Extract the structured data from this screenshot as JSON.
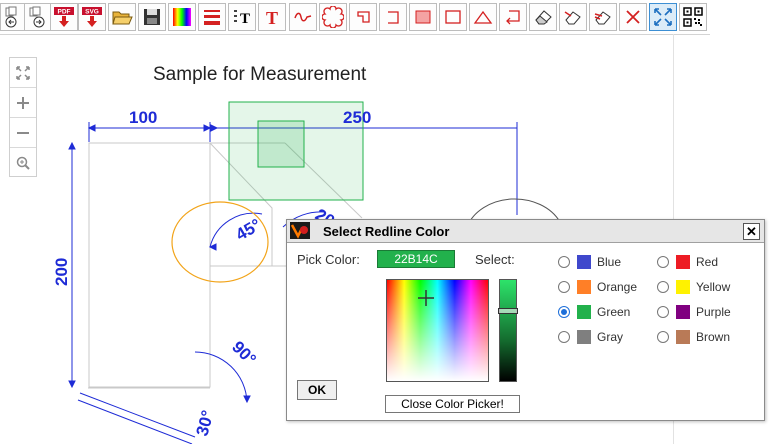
{
  "drawing": {
    "title": "Sample for Measurement",
    "dims": [
      "100",
      "250",
      "200",
      "45°",
      "20",
      "90°",
      "30°"
    ]
  },
  "toolbar": {
    "pdf_label": "PDF",
    "svg_label": "SVG",
    "text_tool_label": "T",
    "colors": {
      "red": "#e0242d",
      "toolbar_border": "#bdbdbd"
    }
  },
  "dialog": {
    "title": "Select Redline Color",
    "close_symbol": "✕",
    "pick_label": "Pick Color:",
    "pick_value": "22B14C",
    "select_label": "Select:",
    "ok_label": "OK",
    "close_picker_label": "Close Color Picker!",
    "options": [
      {
        "label": "Blue",
        "color": "#3f48cc",
        "selected": false
      },
      {
        "label": "Red",
        "color": "#ed1c24",
        "selected": false
      },
      {
        "label": "Orange",
        "color": "#ff7f27",
        "selected": false
      },
      {
        "label": "Yellow",
        "color": "#fff200",
        "selected": false
      },
      {
        "label": "Green",
        "color": "#22b14c",
        "selected": true
      },
      {
        "label": "Purple",
        "color": "#800080",
        "selected": false
      },
      {
        "label": "Gray",
        "color": "#7f7f7f",
        "selected": false
      },
      {
        "label": "Brown",
        "color": "#b97a57",
        "selected": false
      }
    ]
  }
}
